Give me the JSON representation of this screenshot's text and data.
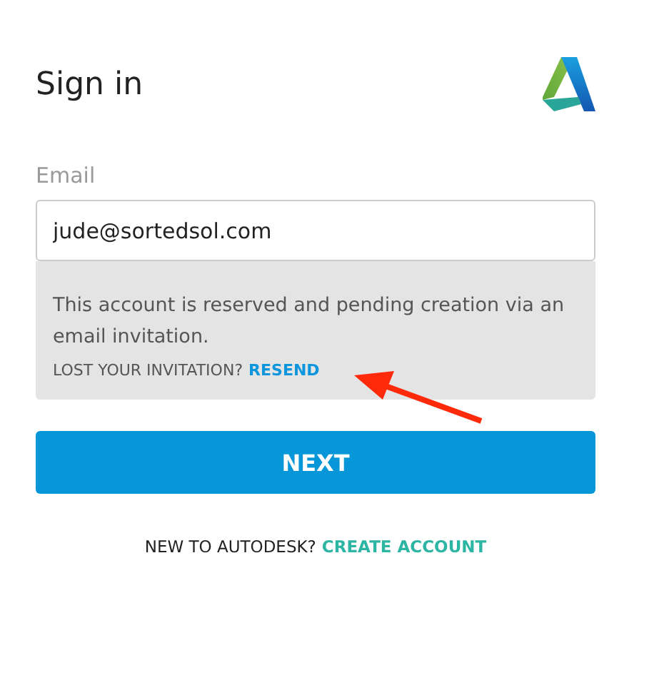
{
  "title": "Sign in",
  "email": {
    "label": "Email",
    "value": "jude@sortedsol.com"
  },
  "notice": {
    "message": "This account is reserved and pending creation via an email invitation.",
    "prompt": "LOST YOUR INVITATION?",
    "link": "RESEND"
  },
  "next_button": "NEXT",
  "footer": {
    "prompt": "NEW TO AUTODESK?",
    "link": "CREATE ACCOUNT"
  },
  "annotation": {
    "kind": "arrow",
    "color": "#ff2a0a"
  }
}
